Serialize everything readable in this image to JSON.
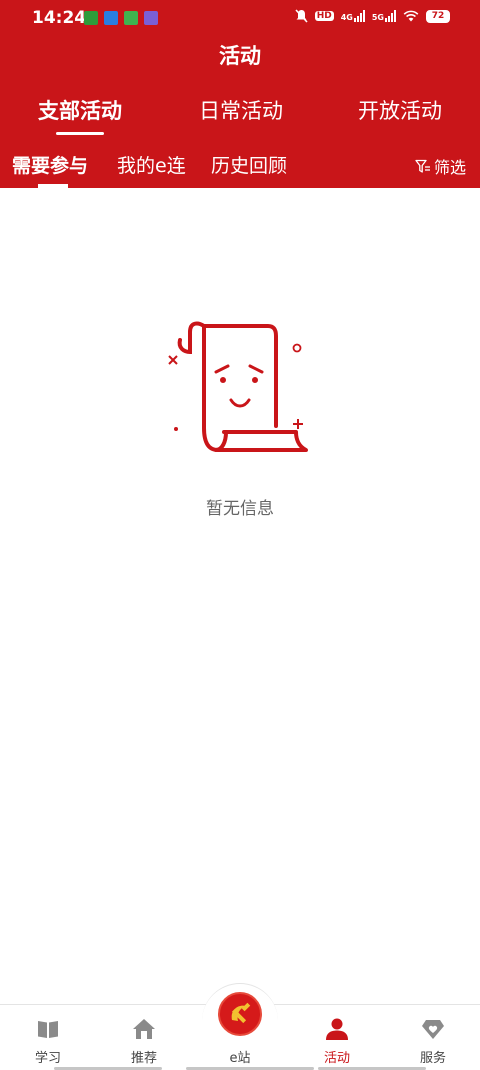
{
  "status_bar": {
    "time": "14:24",
    "hd_label": "HD",
    "net1": "4G",
    "net2": "5G",
    "battery": "72"
  },
  "header": {
    "title": "活动",
    "main_tabs": [
      {
        "label": "支部活动",
        "active": true
      },
      {
        "label": "日常活动",
        "active": false
      },
      {
        "label": "开放活动",
        "active": false
      }
    ],
    "sub_tabs": [
      {
        "label": "需要参与",
        "active": true
      },
      {
        "label": "我的e连",
        "active": false
      },
      {
        "label": "历史回顾",
        "active": false
      }
    ],
    "filter_label": "筛选"
  },
  "empty_state": {
    "message": "暂无信息",
    "icon": "scroll-sad-face-icon"
  },
  "bottom_nav": {
    "items": [
      {
        "label": "学习",
        "icon": "book-icon",
        "active": false
      },
      {
        "label": "推荐",
        "icon": "home-icon",
        "active": false
      },
      {
        "label": "e站",
        "icon": "party-emblem-icon",
        "active": false
      },
      {
        "label": "活动",
        "icon": "person-icon",
        "active": true
      },
      {
        "label": "服务",
        "icon": "diamond-heart-icon",
        "active": false
      }
    ]
  },
  "colors": {
    "brand_red": "#c91519",
    "inactive_icon": "#8a8a8a",
    "text_gray": "#666666"
  }
}
